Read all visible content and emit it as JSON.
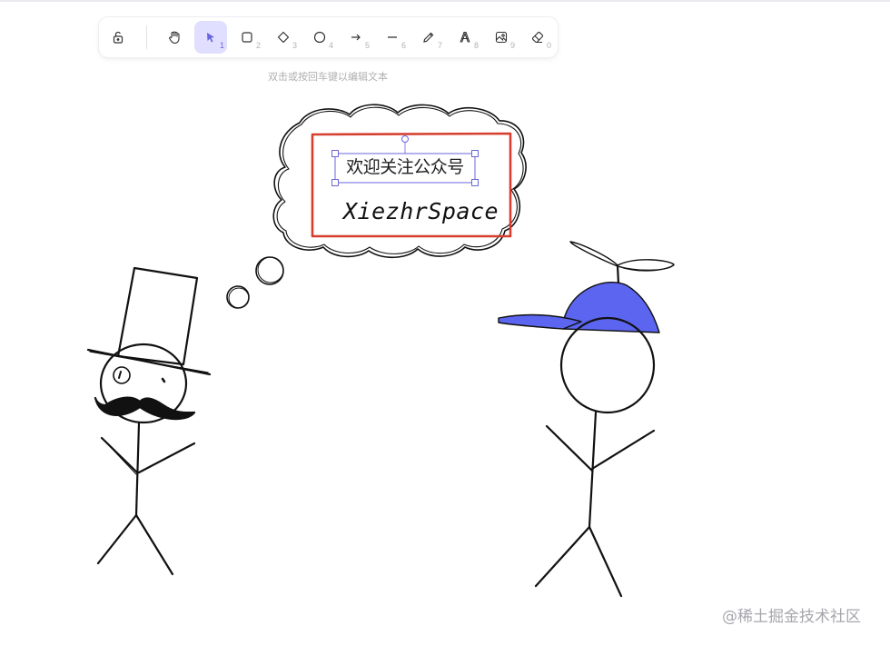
{
  "toolbar": {
    "tools": [
      {
        "name": "lock",
        "key": ""
      },
      {
        "name": "hand",
        "key": ""
      },
      {
        "name": "selection",
        "key": "1"
      },
      {
        "name": "rectangle",
        "key": "2"
      },
      {
        "name": "diamond",
        "key": "3"
      },
      {
        "name": "ellipse",
        "key": "4"
      },
      {
        "name": "arrow",
        "key": "5"
      },
      {
        "name": "line",
        "key": "6"
      },
      {
        "name": "draw",
        "key": "7"
      },
      {
        "name": "text",
        "key": "8"
      },
      {
        "name": "image",
        "key": "9"
      },
      {
        "name": "eraser",
        "key": "0"
      }
    ],
    "active_tool": "selection"
  },
  "hint": "双击或按回车键以编辑文本",
  "canvas": {
    "selected_text": "欢迎关注公众号",
    "handwritten_text": "XiezhrSpace",
    "frame_color": "#d63f2f",
    "selection_color": "#6965db",
    "cap_color": "#5b65ef"
  },
  "watermark": "@稀土掘金技术社区"
}
